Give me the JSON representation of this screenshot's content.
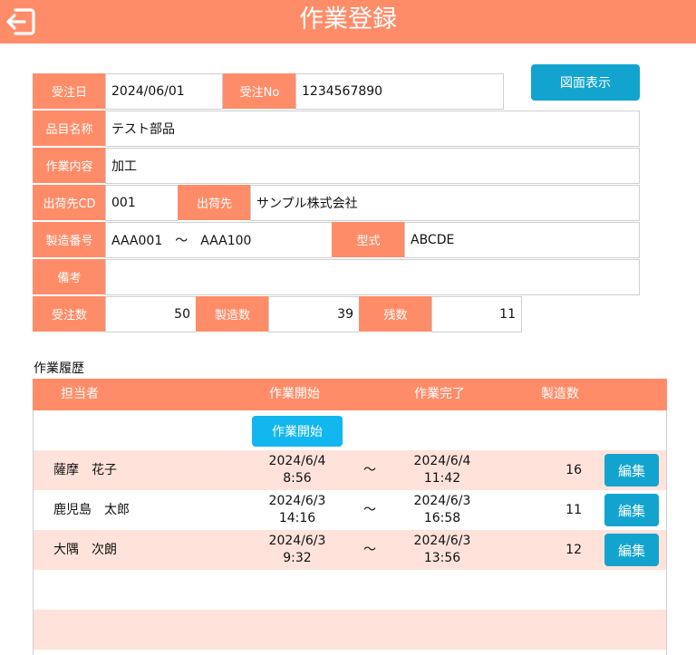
{
  "header": {
    "title": "作業登録",
    "back_icon": "logout-arrow-icon"
  },
  "order": {
    "order_date_label": "受注日",
    "order_date": "2024/06/01",
    "order_no_label": "受注No",
    "order_no": "1234567890",
    "drawing_button": "図面表示",
    "item_name_label": "品目名称",
    "item_name": "テスト部品",
    "work_content_label": "作業内容",
    "work_content": "加工",
    "ship_cd_label": "出荷先CD",
    "ship_cd": "001",
    "ship_to_label": "出荷先",
    "ship_to": "サンプル株式会社",
    "serial_label": "製造番号",
    "serial": "AAA001　～　AAA100",
    "model_label": "型式",
    "model": "ABCDE",
    "remarks_label": "備考",
    "remarks": "",
    "order_qty_label": "受注数",
    "order_qty": "50",
    "made_qty_label": "製造数",
    "made_qty": "39",
    "remain_label": "残数",
    "remain": "11"
  },
  "history": {
    "title": "作業履歴",
    "columns": {
      "person": "担当者",
      "start": "作業開始",
      "end": "作業完了",
      "qty": "製造数"
    },
    "start_button": "作業開始",
    "rows": [
      {
        "name": "薩摩　花子",
        "start_date": "2024/6/4",
        "start_time": "8:56",
        "tilde": "～",
        "end_date": "2024/6/4",
        "end_time": "11:42",
        "qty": "16",
        "edit": "編集"
      },
      {
        "name": "鹿児島　太郎",
        "start_date": "2024/6/3",
        "start_time": "14:16",
        "tilde": "～",
        "end_date": "2024/6/3",
        "end_time": "16:58",
        "qty": "11",
        "edit": "編集"
      },
      {
        "name": "大隅　次朗",
        "start_date": "2024/6/3",
        "start_time": "9:32",
        "tilde": "～",
        "end_date": "2024/6/3",
        "end_time": "13:56",
        "qty": "12",
        "edit": "編集"
      }
    ]
  },
  "colors": {
    "accent": "#ff8c69",
    "row_pink": "#ffe3db",
    "button_blue": "#12a4cf",
    "start_button": "#12b7f0"
  }
}
